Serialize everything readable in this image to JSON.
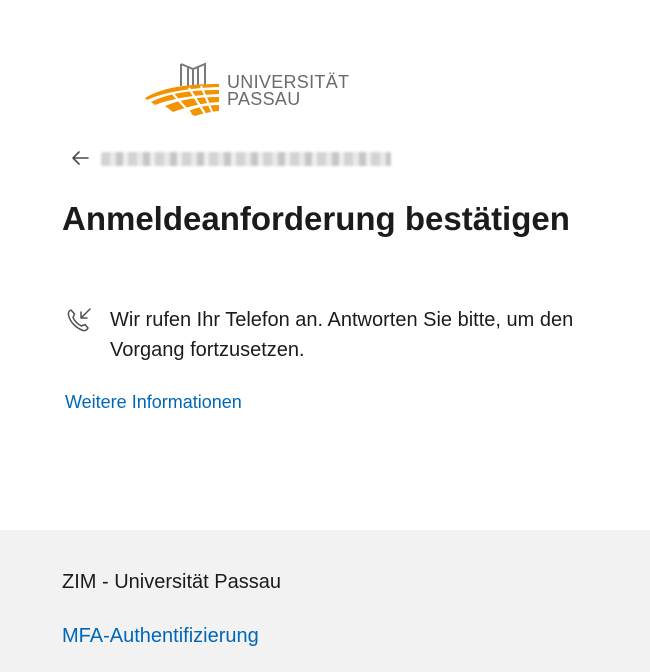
{
  "brand": {
    "logo_line1": "UNIVERSITÄT",
    "logo_line2": "PASSAU",
    "accent_orange": "#f29400",
    "logo_gray": "#6b6b6b"
  },
  "signin": {
    "identity": "████████████████",
    "title": "Anmeldeanforderung bestätigen",
    "call_message": "Wir rufen Ihr Telefon an. Antworten Sie bitte, um den Vorgang fortzusetzen.",
    "more_info_link": "Weitere Informationen"
  },
  "footer": {
    "org_name": "ZIM - Universität Passau",
    "link": "MFA-Authentifizierung"
  },
  "colors": {
    "link": "#0067b8",
    "footer_bg": "#f2f2f2",
    "text": "#1b1b1b"
  }
}
